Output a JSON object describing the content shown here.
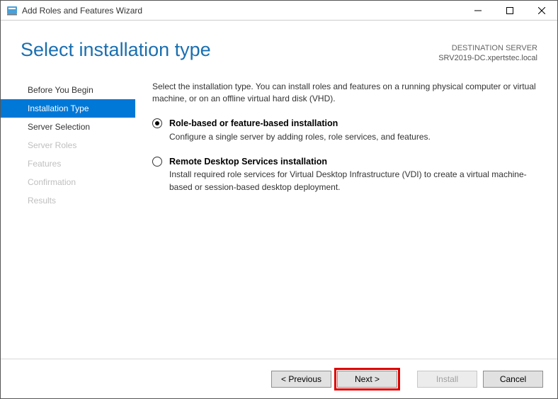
{
  "titlebar": {
    "title": "Add Roles and Features Wizard"
  },
  "header": {
    "page_title": "Select installation type",
    "destination_label": "DESTINATION SERVER",
    "destination_value": "SRV2019-DC.xpertstec.local"
  },
  "sidebar": {
    "items": [
      {
        "label": "Before You Begin",
        "state": "normal"
      },
      {
        "label": "Installation Type",
        "state": "active"
      },
      {
        "label": "Server Selection",
        "state": "normal"
      },
      {
        "label": "Server Roles",
        "state": "disabled"
      },
      {
        "label": "Features",
        "state": "disabled"
      },
      {
        "label": "Confirmation",
        "state": "disabled"
      },
      {
        "label": "Results",
        "state": "disabled"
      }
    ]
  },
  "content": {
    "intro": "Select the installation type. You can install roles and features on a running physical computer or virtual machine, or on an offline virtual hard disk (VHD).",
    "options": [
      {
        "title": "Role-based or feature-based installation",
        "description": "Configure a single server by adding roles, role services, and features.",
        "selected": true
      },
      {
        "title": "Remote Desktop Services installation",
        "description": "Install required role services for Virtual Desktop Infrastructure (VDI) to create a virtual machine-based or session-based desktop deployment.",
        "selected": false
      }
    ]
  },
  "footer": {
    "previous": "< Previous",
    "next": "Next >",
    "install": "Install",
    "cancel": "Cancel"
  }
}
